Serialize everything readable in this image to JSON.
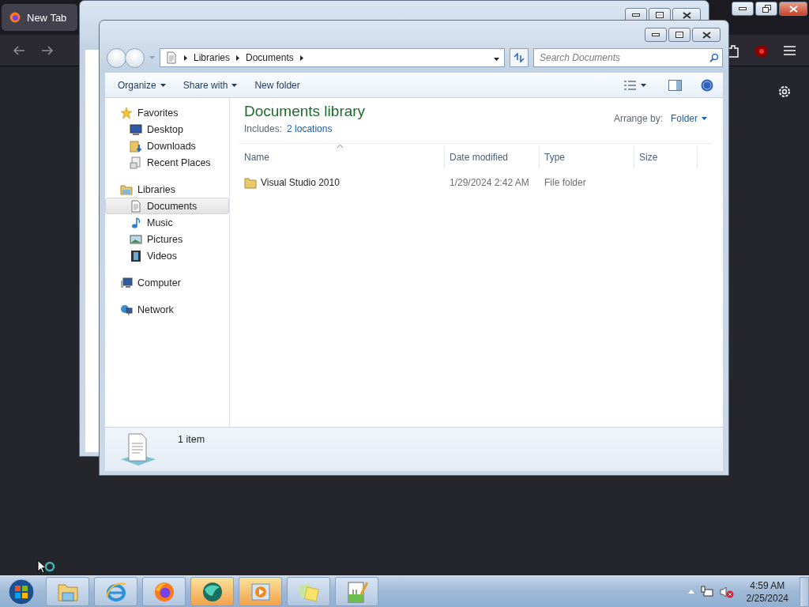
{
  "browser": {
    "tab": {
      "title": "New Tab",
      "selected": true
    }
  },
  "explorer": {
    "breadcrumb": [
      "Libraries",
      "Documents"
    ],
    "search": {
      "placeholder": "Search Documents"
    },
    "commands": [
      {
        "label": "Organize",
        "dropdown": true
      },
      {
        "label": "Share with",
        "dropdown": true
      },
      {
        "label": "New folder",
        "dropdown": false
      }
    ],
    "nav": [
      {
        "label": "Favorites",
        "kind": "favorites",
        "selected": false,
        "children": [
          {
            "label": "Desktop",
            "kind": "desktop",
            "selected": false
          },
          {
            "label": "Downloads",
            "kind": "downloads",
            "selected": false
          },
          {
            "label": "Recent Places",
            "kind": "recent",
            "selected": false
          }
        ]
      },
      {
        "label": "Libraries",
        "kind": "libraries",
        "selected": false,
        "children": [
          {
            "label": "Documents",
            "kind": "documents",
            "selected": true
          },
          {
            "label": "Music",
            "kind": "music",
            "selected": false
          },
          {
            "label": "Pictures",
            "kind": "pictures",
            "selected": false
          },
          {
            "label": "Videos",
            "kind": "videos",
            "selected": false
          }
        ]
      },
      {
        "label": "Computer",
        "kind": "computer",
        "selected": false
      },
      {
        "label": "Network",
        "kind": "network",
        "selected": false
      }
    ],
    "library": {
      "title": "Documents library",
      "includes_label": "Includes:",
      "includes_link": "2 locations",
      "arrange_label": "Arrange by:",
      "arrange_value": "Folder"
    },
    "columns": [
      "Name",
      "Date modified",
      "Type",
      "Size"
    ],
    "rows": [
      {
        "name": "Visual Studio 2010",
        "date": "1/29/2024 2:42 AM",
        "type": "File folder"
      }
    ],
    "status": "1 item"
  },
  "taskbar": {
    "apps": [
      {
        "kind": "explorer",
        "highlighted": false
      },
      {
        "kind": "ie",
        "highlighted": false
      },
      {
        "kind": "firefox",
        "highlighted": false
      },
      {
        "kind": "sphere",
        "highlighted": true
      },
      {
        "kind": "media",
        "highlighted": true
      },
      {
        "kind": "notes",
        "highlighted": false
      },
      {
        "kind": "notepad",
        "highlighted": false
      }
    ],
    "time": "4:59 AM",
    "date": "2/25/2024"
  }
}
